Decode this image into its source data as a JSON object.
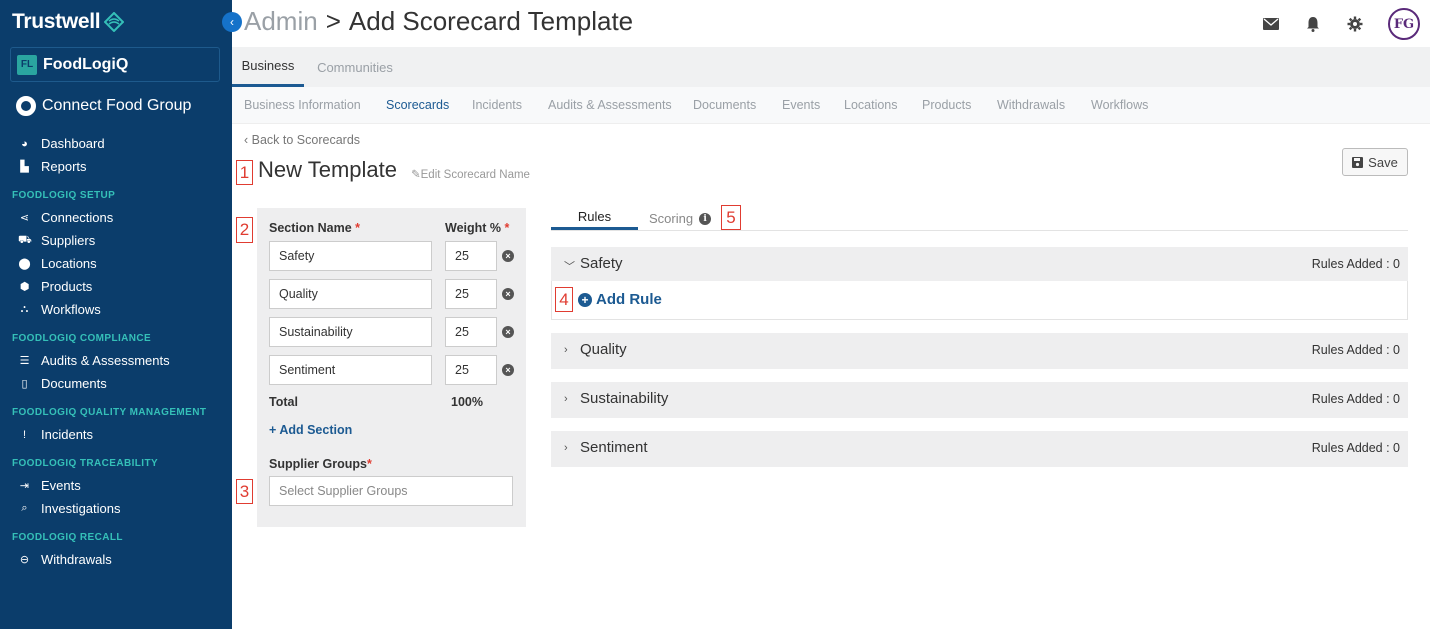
{
  "sidebar": {
    "brand": "Trustwell",
    "product": {
      "logo": "FL",
      "name": "FoodLogiQ"
    },
    "org": "Connect Food Group",
    "items_top": [
      {
        "label": "Dashboard",
        "icon": "dashboard-icon",
        "glyph": "◕"
      },
      {
        "label": "Reports",
        "icon": "bar-chart-icon",
        "glyph": "▙"
      }
    ],
    "setup_header": "FOODLOGIQ SETUP",
    "setup_items": [
      {
        "label": "Connections",
        "icon": "share-icon",
        "glyph": "⋖"
      },
      {
        "label": "Suppliers",
        "icon": "truck-icon",
        "glyph": "⛟"
      },
      {
        "label": "Locations",
        "icon": "map-pin-icon",
        "glyph": "⬤"
      },
      {
        "label": "Products",
        "icon": "box-icon",
        "glyph": "⬢"
      },
      {
        "label": "Workflows",
        "icon": "sitemap-icon",
        "glyph": "⛬"
      }
    ],
    "compliance_header": "FOODLOGIQ COMPLIANCE",
    "compliance_items": [
      {
        "label": "Audits & Assessments",
        "icon": "list-icon",
        "glyph": "☰"
      },
      {
        "label": "Documents",
        "icon": "file-icon",
        "glyph": "▯"
      }
    ],
    "quality_header": "FOODLOGIQ QUALITY MANAGEMENT",
    "quality_items": [
      {
        "label": "Incidents",
        "icon": "exclamation-icon",
        "glyph": "!"
      }
    ],
    "traceability_header": "FOODLOGIQ TRACEABILITY",
    "traceability_items": [
      {
        "label": "Events",
        "icon": "sign-out-icon",
        "glyph": "⇥"
      },
      {
        "label": "Investigations",
        "icon": "search-icon",
        "glyph": "⌕"
      }
    ],
    "recall_header": "FOODLOGIQ RECALL",
    "recall_items": [
      {
        "label": "Withdrawals",
        "icon": "minus-circle-icon",
        "glyph": "⊖"
      }
    ]
  },
  "header": {
    "crumb_parent": "Admin",
    "crumb_sep": ">",
    "crumb_current": "Add Scorecard Template",
    "avatar_initials": "FG"
  },
  "tabs_primary": [
    "Business",
    "Communities"
  ],
  "tabs_secondary": [
    "Business Information",
    "Scorecards",
    "Incidents",
    "Audits & Assessments",
    "Documents",
    "Events",
    "Locations",
    "Products",
    "Withdrawals",
    "Workflows"
  ],
  "page": {
    "back_link": "Back to Scorecards",
    "title": "New Template",
    "edit_name": "Edit Scorecard Name",
    "save_label": "Save"
  },
  "markers": [
    "1",
    "2",
    "3",
    "4",
    "5"
  ],
  "sections_panel": {
    "section_name_label": "Section Name",
    "weight_label": "Weight %",
    "required_mark": "*",
    "rows": [
      {
        "name": "Safety",
        "weight": "25"
      },
      {
        "name": "Quality",
        "weight": "25"
      },
      {
        "name": "Sustainability",
        "weight": "25"
      },
      {
        "name": "Sentiment",
        "weight": "25"
      }
    ],
    "total_label": "Total",
    "total_value": "100%",
    "add_section": "Add Section",
    "supplier_groups_label": "Supplier Groups",
    "supplier_groups_placeholder": "Select Supplier Groups"
  },
  "rules": {
    "tabs": [
      "Rules",
      "Scoring"
    ],
    "add_rule": "Add Rule",
    "accordions": [
      {
        "name": "Safety",
        "count": "Rules Added : 0",
        "expanded": true
      },
      {
        "name": "Quality",
        "count": "Rules Added : 0",
        "expanded": false
      },
      {
        "name": "Sustainability",
        "count": "Rules Added : 0",
        "expanded": false
      },
      {
        "name": "Sentiment",
        "count": "Rules Added : 0",
        "expanded": false
      }
    ]
  },
  "colors": {
    "sidebar_bg": "#0b3d6b",
    "accent": "#1c5a92",
    "section_header": "#35c0b8",
    "marker": "#e03c31"
  }
}
